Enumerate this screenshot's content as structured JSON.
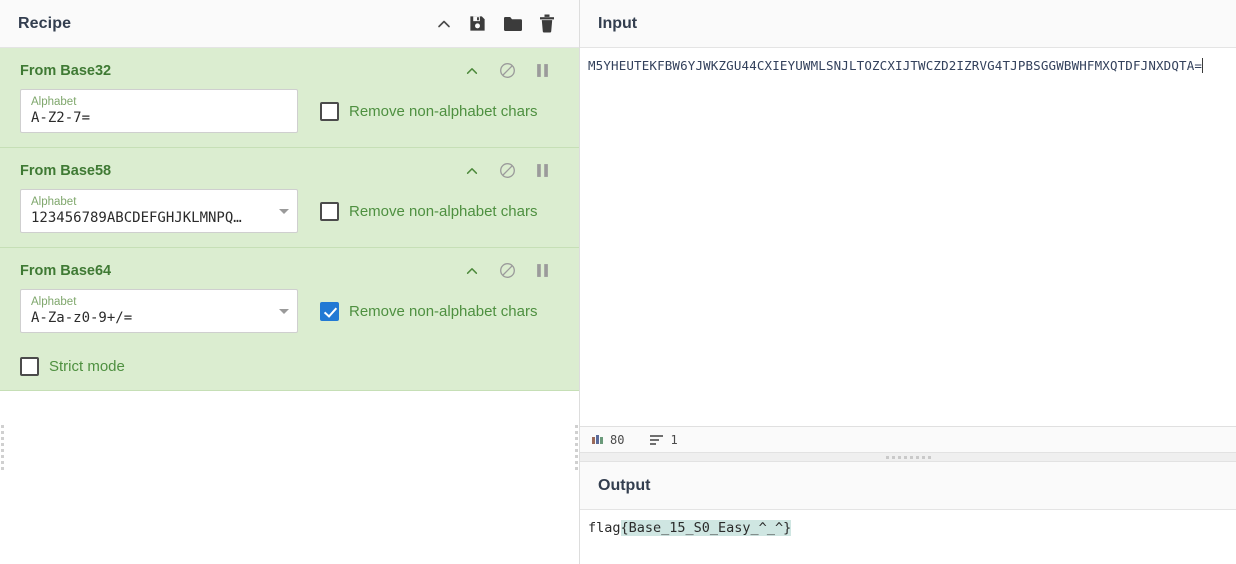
{
  "recipe": {
    "title": "Recipe",
    "header_icons": [
      {
        "name": "collapse-chevron-icon",
        "label": "Collapse"
      },
      {
        "name": "save-icon",
        "label": "Save recipe"
      },
      {
        "name": "folder-icon",
        "label": "Load recipe"
      },
      {
        "name": "trash-icon",
        "label": "Clear recipe"
      }
    ],
    "operations": [
      {
        "title": "From Base32",
        "arg_label": "Alphabet",
        "arg_value": "A-Z2-7=",
        "has_dropdown": false,
        "checkbox_label": "Remove non-alphabet chars",
        "checkbox_checked": false,
        "extra_checkbox_label": null,
        "extra_checkbox_checked": false
      },
      {
        "title": "From Base58",
        "arg_label": "Alphabet",
        "arg_value": "123456789ABCDEFGHJKLMNPQ…",
        "has_dropdown": true,
        "checkbox_label": "Remove non-alphabet chars",
        "checkbox_checked": false,
        "extra_checkbox_label": null,
        "extra_checkbox_checked": false
      },
      {
        "title": "From Base64",
        "arg_label": "Alphabet",
        "arg_value": "A-Za-z0-9+/=",
        "has_dropdown": true,
        "checkbox_label": "Remove non-alphabet chars",
        "checkbox_checked": true,
        "extra_checkbox_label": "Strict mode",
        "extra_checkbox_checked": false
      }
    ],
    "op_icons": [
      {
        "name": "op-collapse-chevron-icon"
      },
      {
        "name": "op-disable-icon"
      },
      {
        "name": "op-breakpoint-pause-icon"
      }
    ]
  },
  "input": {
    "title": "Input",
    "value": "M5YHEUTEKFBW6YJWKZGU44CXIEYUWMLSNJLTOZCXIJTWCZD2IZRVG4TJPBSGGWBWHFMXQTDFJNXDQTA=",
    "status": {
      "length_icon": "abc-length-icon",
      "length": "80",
      "lines_icon": "line-count-icon",
      "lines": "1"
    }
  },
  "output": {
    "title": "Output",
    "prefix": "flag",
    "highlight": "{Base_15_S0_Easy_^_^}"
  },
  "colors": {
    "op_background": "#dbedd0",
    "op_title": "#3f7a34",
    "checkbox_checked": "#2279d4",
    "highlight": "#cfe6e2",
    "panel_header": "#fafafa"
  }
}
